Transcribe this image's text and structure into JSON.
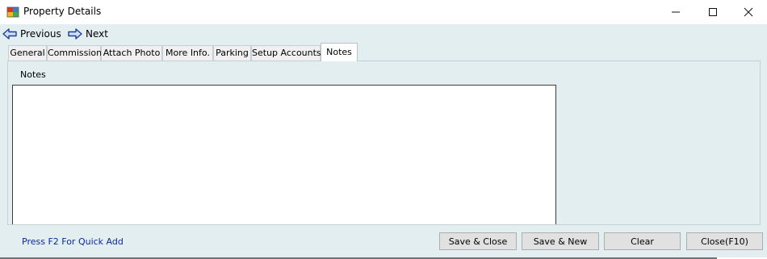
{
  "window": {
    "title": "Property Details",
    "app_icon": "form-icon",
    "controls": [
      "minimize-icon",
      "maximize-icon",
      "close-icon"
    ]
  },
  "nav": {
    "previous_label": "Previous",
    "next_label": "Next",
    "previous_icon": "arrow-left-icon",
    "next_icon": "arrow-right-icon"
  },
  "tabs": [
    {
      "label": "General"
    },
    {
      "label": "Commission"
    },
    {
      "label": "Attach Photo"
    },
    {
      "label": "More Info."
    },
    {
      "label": "Parking"
    },
    {
      "label": "Setup Accounts"
    },
    {
      "label": "Notes"
    }
  ],
  "active_tab": "Notes",
  "notes": {
    "label": "Notes",
    "value": ""
  },
  "footer": {
    "hint": "Press F2 For Quick Add",
    "buttons": {
      "save_close": "Save & Close",
      "save_new": "Save & New",
      "clear": "Clear",
      "close": "Close(F10)"
    }
  },
  "colors": {
    "client_bg": "#e3eef1",
    "hint_text": "#0b2a9c",
    "nav_arrow": "#1f3d99"
  }
}
